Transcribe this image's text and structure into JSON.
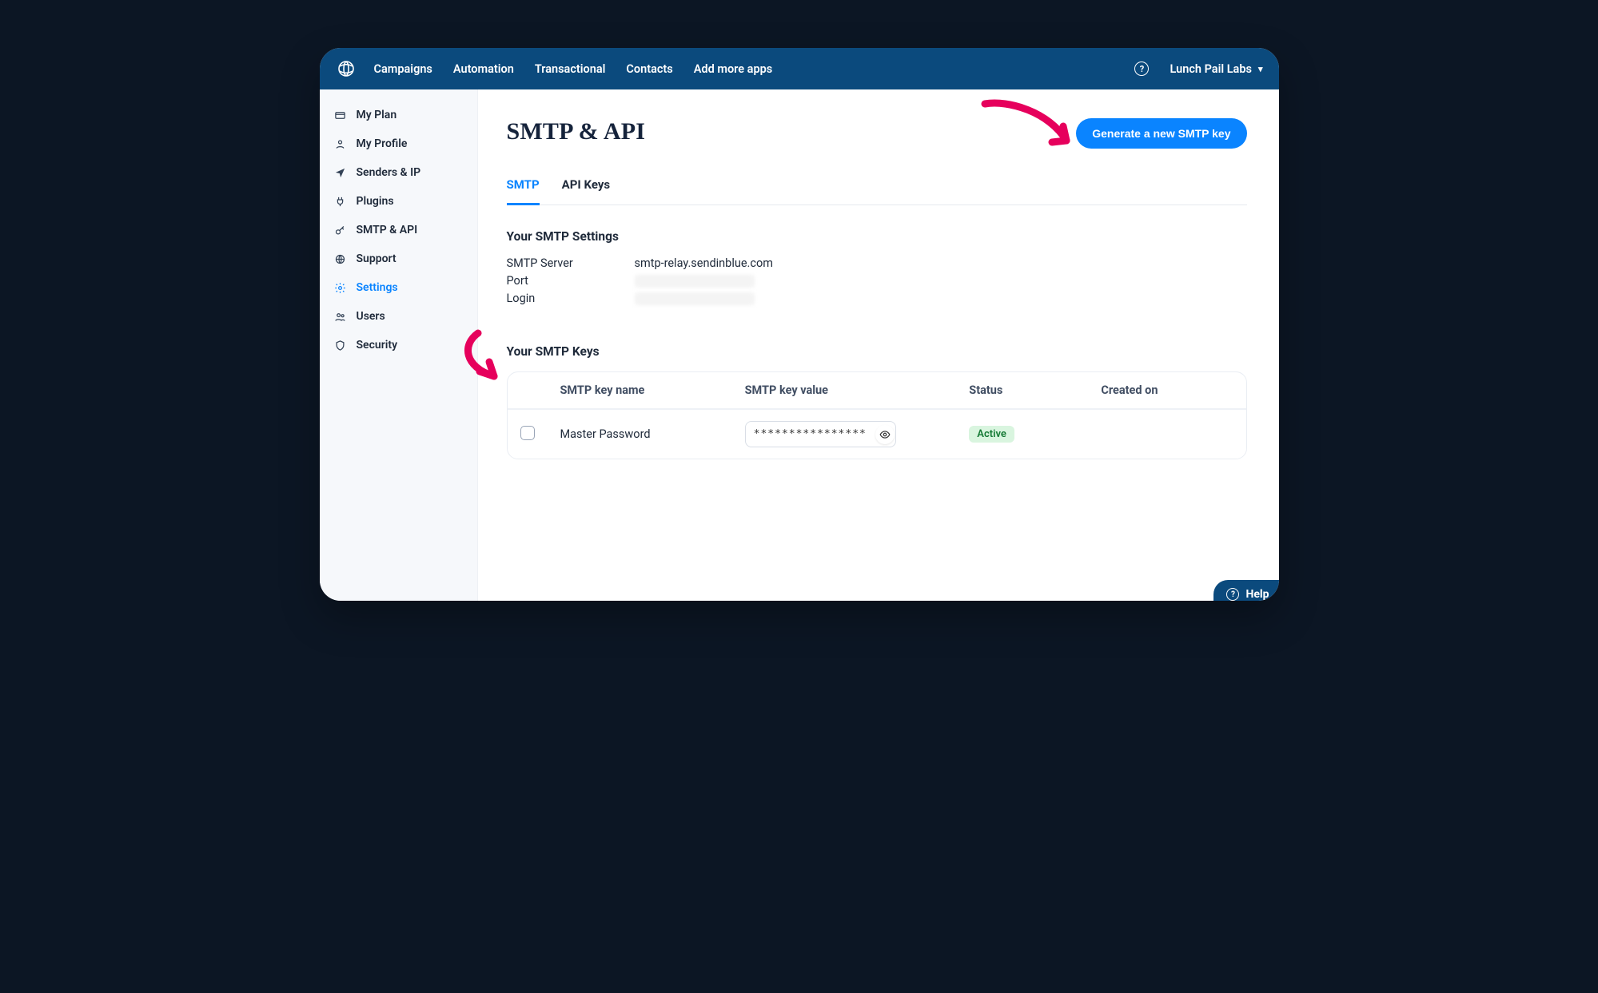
{
  "topnav": {
    "links": [
      "Campaigns",
      "Automation",
      "Transactional",
      "Contacts",
      "Add more apps"
    ],
    "account_name": "Lunch Pail Labs"
  },
  "sidebar": {
    "items": [
      {
        "label": "My Plan",
        "icon": "card-icon"
      },
      {
        "label": "My Profile",
        "icon": "user-icon"
      },
      {
        "label": "Senders & IP",
        "icon": "send-icon"
      },
      {
        "label": "Plugins",
        "icon": "plug-icon"
      },
      {
        "label": "SMTP & API",
        "icon": "key-icon"
      },
      {
        "label": "Support",
        "icon": "globe-icon"
      },
      {
        "label": "Settings",
        "icon": "gear-icon",
        "active": true
      },
      {
        "label": "Users",
        "icon": "users-icon"
      },
      {
        "label": "Security",
        "icon": "shield-icon"
      }
    ]
  },
  "page": {
    "title": "SMTP & API",
    "generate_button": "Generate a new SMTP key",
    "tabs": {
      "smtp": "SMTP",
      "api": "API Keys",
      "active": "smtp"
    },
    "settings_heading": "Your SMTP Settings",
    "settings": {
      "server_label": "SMTP Server",
      "server_value": "smtp-relay.sendinblue.com",
      "port_label": "Port",
      "port_value": "",
      "login_label": "Login",
      "login_value": ""
    },
    "keys_heading": "Your SMTP Keys",
    "keys_table": {
      "headers": {
        "name": "SMTP key name",
        "value": "SMTP key value",
        "status": "Status",
        "created": "Created on"
      },
      "rows": [
        {
          "name": "Master Password",
          "value_masked": "****************",
          "status": "Active",
          "created": ""
        }
      ]
    }
  },
  "help_fab": {
    "label": "Help"
  },
  "colors": {
    "accent": "#0a84ff",
    "navbar": "#0b4a7d",
    "annotation": "#e6005c"
  }
}
